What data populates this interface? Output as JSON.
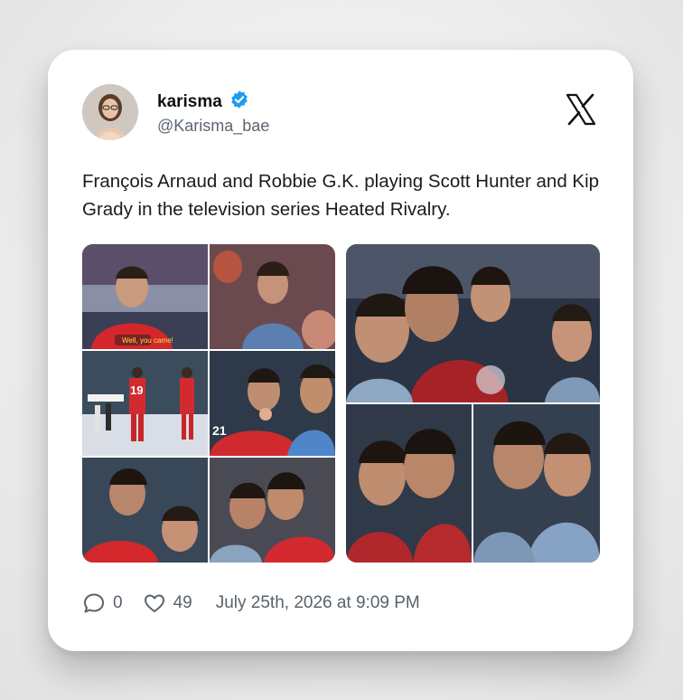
{
  "post": {
    "display_name": "karisma",
    "verified_icon": "verified-badge-icon",
    "handle": "@Karisma_bae",
    "text": "François Arnaud and Robbie G.K. playing Scott Hunter and Kip Grady in the television series Heated Rivalry.",
    "brand_icon": "x-logo-icon",
    "colors": {
      "verified": "#1d9bf0",
      "text": "#1b1b1b",
      "muted": "#58626b"
    }
  },
  "media": {
    "left_collage_caption": "Well, you came!",
    "jersey_number_1": "19",
    "jersey_number_2": "21"
  },
  "footer": {
    "reply_icon": "reply-icon",
    "reply_count": "0",
    "like_icon": "heart-icon",
    "like_count": "49",
    "timestamp": "July 25th, 2026 at 9:09 PM"
  }
}
